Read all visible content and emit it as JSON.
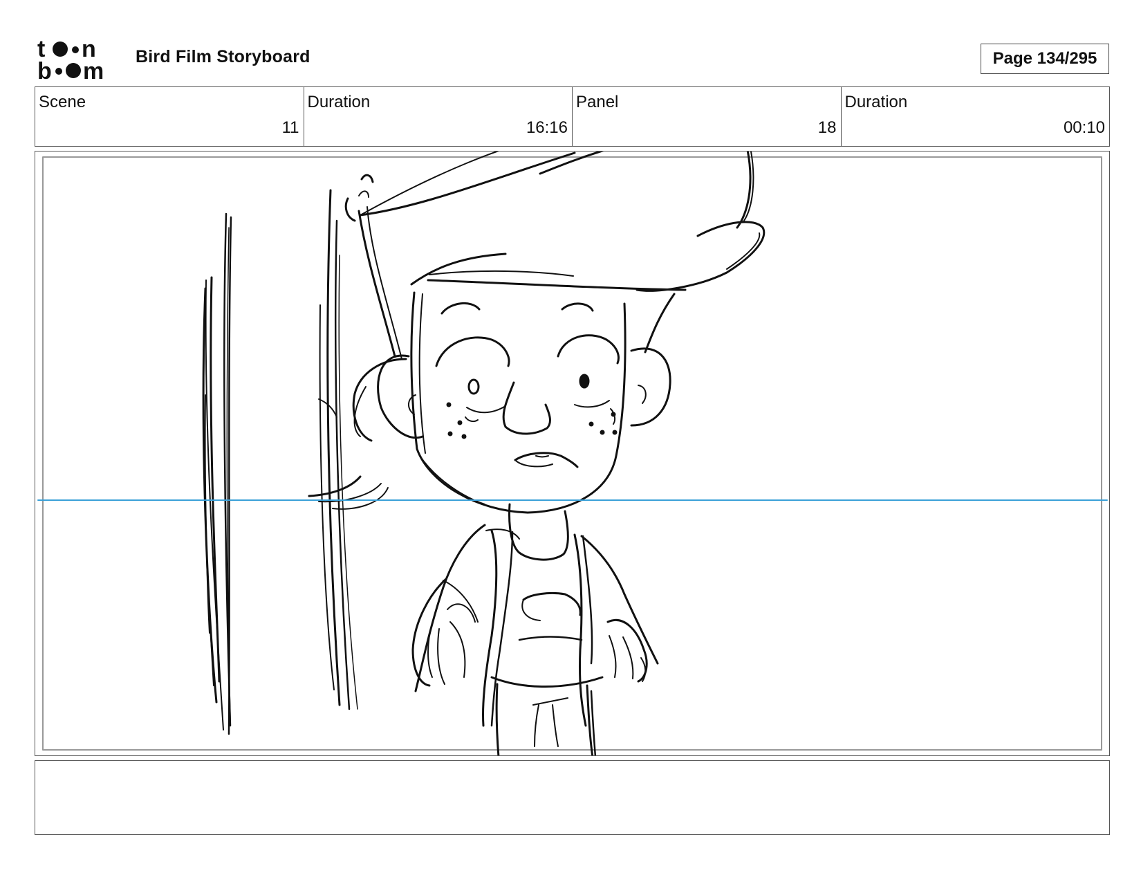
{
  "header": {
    "logo_text_top": "toon",
    "logo_text_bottom": "boom",
    "title": "Bird Film Storyboard",
    "page": "Page 134/295"
  },
  "info": {
    "scene_label": "Scene",
    "scene_value": "11",
    "duration_label": "Duration",
    "duration_value": "16:16",
    "panel_label": "Panel",
    "panel_value": "18",
    "panel_duration_label": "Duration",
    "panel_duration_value": "00:10"
  },
  "panel": {
    "guide_line_color": "#3aa0d8",
    "sketch_color": "#111111"
  },
  "notes": {
    "text": ""
  }
}
